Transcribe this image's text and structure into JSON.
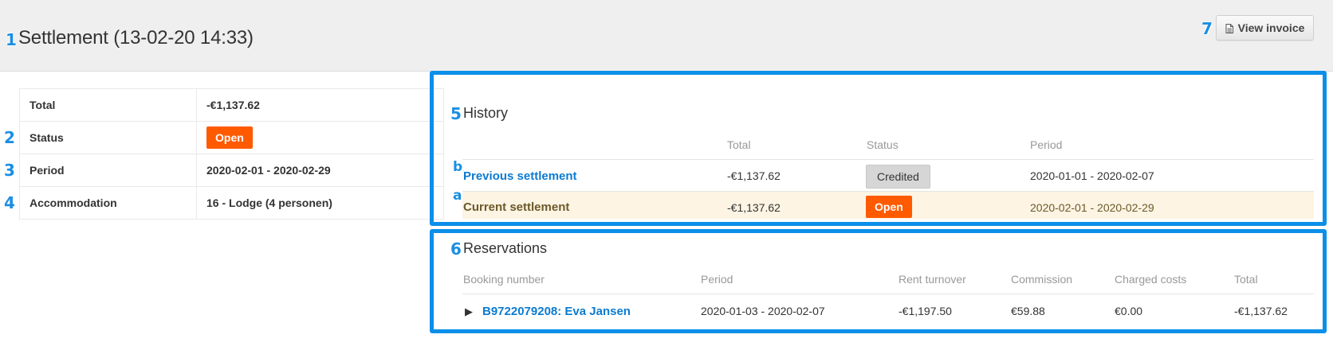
{
  "header": {
    "title": "Settlement (13-02-20 14:33)",
    "view_invoice_label": "View invoice"
  },
  "markers": {
    "m1": "1",
    "m2": "2",
    "m3": "3",
    "m4": "4",
    "m5": "5",
    "m6": "6",
    "m7": "7",
    "ma": "a",
    "mb": "b"
  },
  "summary": {
    "rows": [
      {
        "label": "Total",
        "value": "-€1,137.62"
      },
      {
        "label": "Status",
        "value": "Open"
      },
      {
        "label": "Period",
        "value": "2020-02-01 - 2020-02-29"
      },
      {
        "label": "Accommodation",
        "value": "16 - Lodge (4 personen)"
      }
    ]
  },
  "history": {
    "title": "History",
    "columns": [
      "Total",
      "Status",
      "Period"
    ],
    "rows": [
      {
        "name": "Previous settlement",
        "total": "-€1,137.62",
        "status": "Credited",
        "period": "2020-01-01 - 2020-02-07"
      },
      {
        "name": "Current settlement",
        "total": "-€1,137.62",
        "status": "Open",
        "period": "2020-02-01 - 2020-02-29"
      }
    ]
  },
  "reservations": {
    "title": "Reservations",
    "columns": [
      "Booking number",
      "Period",
      "Rent turnover",
      "Commission",
      "Charged costs",
      "Total"
    ],
    "rows": [
      {
        "booking": "B9722079208: Eva Jansen",
        "period": "2020-01-03 - 2020-02-07",
        "rent_turnover": "-€1,197.50",
        "commission": "€59.88",
        "charged_costs": "€0.00",
        "total": "-€1,137.62"
      }
    ]
  },
  "colors": {
    "accent_blue": "#0b8fe8",
    "open_orange": "#ff5a00",
    "credited_gray": "#d6d6d6",
    "current_row_bg": "#fdf4e3"
  }
}
